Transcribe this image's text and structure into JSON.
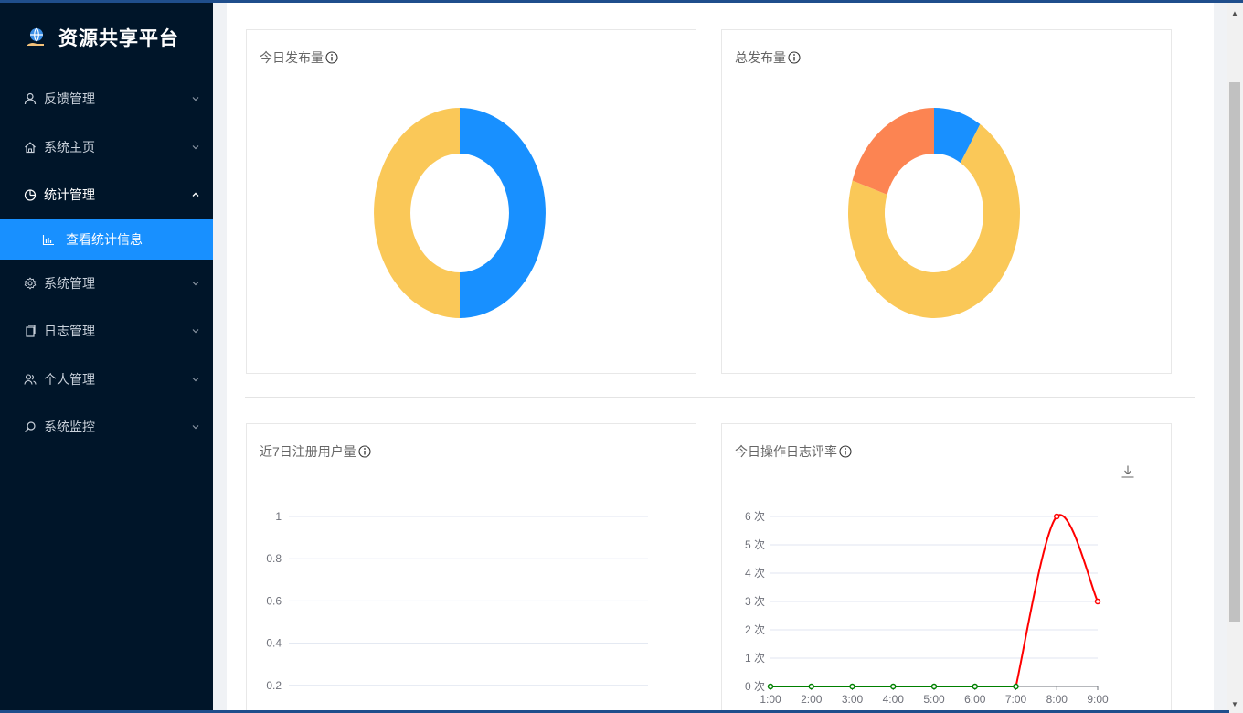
{
  "app": {
    "title": "资源共享平台"
  },
  "sidebar": {
    "items": [
      {
        "label": "反馈管理",
        "icon": "user-icon",
        "expanded": false
      },
      {
        "label": "系统主页",
        "icon": "home-icon",
        "expanded": false
      },
      {
        "label": "统计管理",
        "icon": "pie-chart-icon",
        "expanded": true
      },
      {
        "label": "系统管理",
        "icon": "gear-icon",
        "expanded": false
      },
      {
        "label": "日志管理",
        "icon": "copy-icon",
        "expanded": false
      },
      {
        "label": "个人管理",
        "icon": "users-icon",
        "expanded": false
      },
      {
        "label": "系统监控",
        "icon": "search-monitor-icon",
        "expanded": false
      }
    ],
    "active_sub": {
      "label": "查看统计信息",
      "icon": "bar-chart-icon"
    },
    "colors": {
      "background": "#001529",
      "active": "#1890ff"
    }
  },
  "cards": {
    "today_publish": {
      "title": "今日发布量"
    },
    "total_publish": {
      "title": "总发布量"
    },
    "registered_7d": {
      "title": "近7日注册用户量"
    },
    "op_log": {
      "title": "今日操作日志评率"
    }
  },
  "chart_data": [
    {
      "type": "pie",
      "title": "今日发布量",
      "donut": true,
      "slices": [
        {
          "value": 50,
          "color": "#1890ff"
        },
        {
          "value": 50,
          "color": "#fac858"
        }
      ]
    },
    {
      "type": "pie",
      "title": "总发布量",
      "donut": true,
      "slices": [
        {
          "value": 9,
          "color": "#1890ff"
        },
        {
          "value": 71,
          "color": "#fac858"
        },
        {
          "value": 20,
          "color": "#fc8452"
        }
      ]
    },
    {
      "type": "line",
      "title": "近7日注册用户量",
      "yticks": [
        "1",
        "0.8",
        "0.6",
        "0.4",
        "0.2"
      ],
      "ylim": [
        0,
        1
      ],
      "grid": true,
      "series": []
    },
    {
      "type": "line",
      "title": "今日操作日志评率",
      "x": [
        "1:00",
        "2:00",
        "3:00",
        "4:00",
        "5:00",
        "6:00",
        "7:00",
        "8:00",
        "9:00"
      ],
      "yticks": [
        "6 次",
        "5 次",
        "4 次",
        "3 次",
        "2 次",
        "1 次",
        "0 次"
      ],
      "ylim": [
        0,
        6
      ],
      "grid": true,
      "series": [
        {
          "values": [
            0,
            0,
            0,
            0,
            0,
            0,
            0,
            6,
            3
          ],
          "color_low": "#008000",
          "color_high": "#ff0000"
        }
      ],
      "toolbox": "download-icon"
    }
  ]
}
